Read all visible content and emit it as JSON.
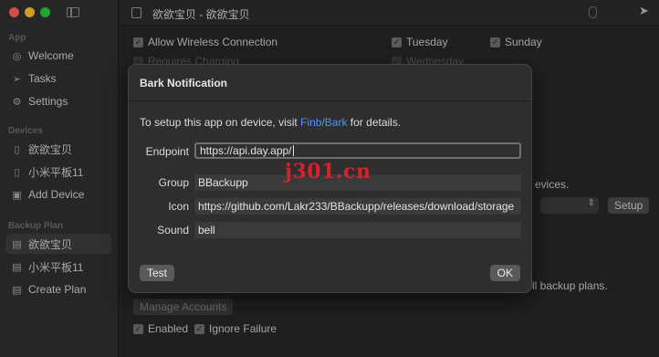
{
  "app": {
    "title": "欲欲宝贝 - 欲欲宝贝",
    "traffic_colors": {
      "close": "#ff5f57",
      "minimize": "#febc2e",
      "zoom": "#28c840"
    }
  },
  "sidebar": {
    "sections": [
      {
        "label": "App",
        "items": [
          {
            "label": "Welcome",
            "icon": "globe-icon"
          },
          {
            "label": "Tasks",
            "icon": "send-icon"
          },
          {
            "label": "Settings",
            "icon": "gear-icon"
          }
        ]
      },
      {
        "label": "Devices",
        "items": [
          {
            "label": "欲欲宝贝",
            "icon": "phone-icon"
          },
          {
            "label": "小米平板11",
            "icon": "phone-icon"
          },
          {
            "label": "Add Device",
            "icon": "add-device-icon"
          }
        ]
      },
      {
        "label": "Backup Plan",
        "items": [
          {
            "label": "欲欲宝贝",
            "icon": "drive-icon",
            "active": true
          },
          {
            "label": "小米平板11",
            "icon": "drive-icon"
          },
          {
            "label": "Create Plan",
            "icon": "drive-add-icon"
          }
        ]
      }
    ]
  },
  "background": {
    "allow_wireless": "Allow Wireless Connection",
    "requires_charging": "Requires Charging",
    "tuesday": "Tuesday",
    "sunday": "Sunday",
    "wednesday": "Wednesday",
    "devices_suffix": "evices.",
    "setup_button": "Setup",
    "backup_plans_suffix": "ll backup plans.",
    "manage_accounts": "Manage Accounts",
    "enabled": "Enabled",
    "ignore_failure": "Ignore Failure"
  },
  "modal": {
    "title": "Bark Notification",
    "intro_before": "To setup this app on device, visit ",
    "intro_link": "Finb/Bark",
    "intro_after": " for details.",
    "fields": {
      "endpoint": {
        "label": "Endpoint",
        "value": "https://api.day.app/"
      },
      "group": {
        "label": "Group",
        "value": "BBackupp"
      },
      "icon": {
        "label": "Icon",
        "value": "https://github.com/Lakr233/BBackupp/releases/download/storage"
      },
      "sound": {
        "label": "Sound",
        "value": "bell"
      }
    },
    "test_button": "Test",
    "ok_button": "OK"
  },
  "watermark": "j301.cn"
}
